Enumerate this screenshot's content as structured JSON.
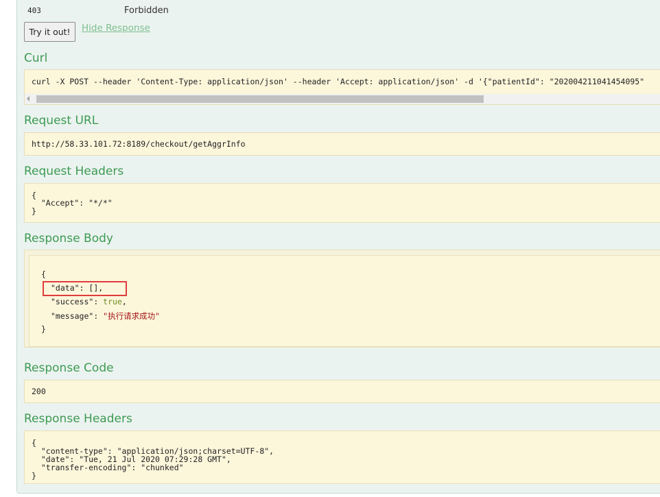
{
  "status": {
    "code": "403",
    "text": "Forbidden"
  },
  "buttons": {
    "try": "Try it out!",
    "hide": "Hide Response"
  },
  "sections": {
    "curl": "Curl",
    "request_url": "Request URL",
    "request_headers": "Request Headers",
    "response_body": "Response Body",
    "response_code": "Response Code",
    "response_headers": "Response Headers"
  },
  "curl_command": "curl -X POST --header 'Content-Type: application/json' --header 'Accept: application/json' -d '{\"patientId\": \"202004211041454095\"",
  "request_url": "http://58.33.101.72:8189/checkout/getAggrInfo",
  "request_headers": {
    "open": "{",
    "line1": "  \"Accept\": \"*/*\"",
    "close": "}"
  },
  "response_body": {
    "open": "{",
    "data_key": "\"data\"",
    "data_val": ": [],",
    "success_key": "\"success\"",
    "success_sep": ": ",
    "success_val": "true",
    "success_end": ",",
    "message_key": "\"message\"",
    "message_sep": ": ",
    "message_val": "\"执行请求成功\"",
    "close": "}"
  },
  "response_code": "200",
  "response_headers": {
    "open": "{",
    "line1": "  \"content-type\": \"application/json;charset=UTF-8\",",
    "line2": "  \"date\": \"Tue, 21 Jul 2020 07:29:28 GMT\",",
    "line3": "  \"transfer-encoding\": \"chunked\"",
    "close": "}"
  },
  "colors": {
    "heading": "#3d9a52",
    "panel_bg": "#ebf3f0",
    "code_bg": "#fcf6db",
    "highlight": "#e03c3c",
    "string": "#a31515",
    "boolean": "#6b8e23"
  }
}
